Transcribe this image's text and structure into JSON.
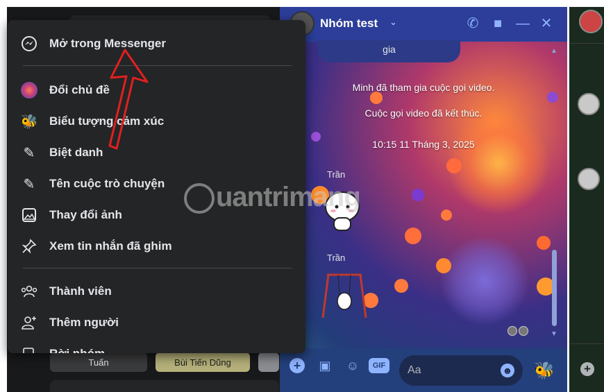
{
  "menu": {
    "open_messenger": "Mở trong Messenger",
    "change_theme": "Đổi chủ đề",
    "emoji": "Biểu tượng cảm xúc",
    "nicknames": "Biệt danh",
    "conversation_name": "Tên cuộc trò chuyện",
    "change_photo": "Thay đổi ảnh",
    "pinned_messages": "Xem tin nhắn đã ghim",
    "members": "Thành viên",
    "add_people": "Thêm người",
    "truncated_item": "Rời nhóm"
  },
  "chat": {
    "title": "Nhóm test",
    "previous_message": "gia",
    "system_joined": "Minh đã tham gia cuộc gọi video.",
    "system_ended": "Cuộc gọi video đã kết thúc.",
    "timestamp": "10:15 11 Tháng 3, 2025",
    "sender_1": "Trần",
    "sender_2": "Trần",
    "input_placeholder": "Aa"
  },
  "background": {
    "pill_1": "Tuấn",
    "pill_2": "Bùi Tiến Dũng"
  },
  "watermark": "uantrimang",
  "colors": {
    "menu_bg": "#242526",
    "menu_text": "#e4e6eb",
    "chat_header": "#2c3e9a",
    "accent_icon": "#8fb4ff",
    "arrow_red": "#e02020"
  },
  "icons": {
    "open_messenger": "messenger-icon",
    "change_theme": "theme-icon",
    "emoji": "bee-emoji-icon",
    "nicknames": "pencil-icon",
    "conversation_name": "pencil-icon",
    "change_photo": "image-icon",
    "pinned_messages": "pin-icon",
    "members": "members-icon",
    "add_people": "add-person-icon"
  }
}
